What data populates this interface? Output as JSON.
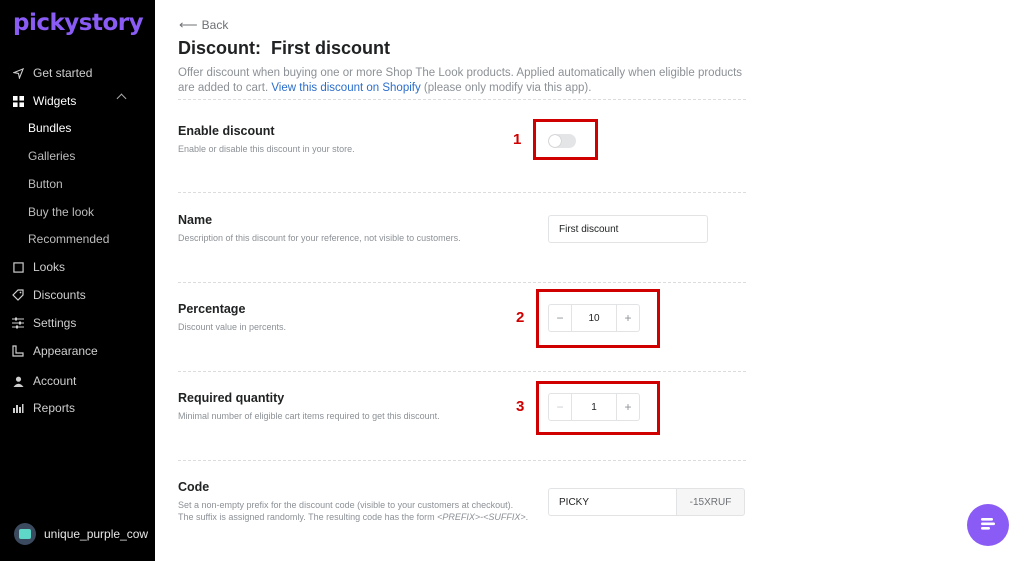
{
  "brand": {
    "logo": "pickystory",
    "accent": "#8a5cf5"
  },
  "sidebar": {
    "items": [
      {
        "label": "Get started",
        "icon": "send-icon"
      },
      {
        "label": "Widgets",
        "icon": "widgets-icon"
      },
      {
        "label": "Looks",
        "icon": "book-icon"
      },
      {
        "label": "Discounts",
        "icon": "tag-icon"
      },
      {
        "label": "Settings",
        "icon": "sliders-icon"
      },
      {
        "label": "Appearance",
        "icon": "ruler-icon"
      },
      {
        "label": "Account",
        "icon": "person-icon"
      },
      {
        "label": "Reports",
        "icon": "chart-icon"
      }
    ],
    "widgets_sub": [
      "Bundles",
      "Galleries",
      "Button",
      "Buy the look",
      "Recommended"
    ],
    "active_sub": "Bundles"
  },
  "user": {
    "name": "unique_purple_cow"
  },
  "header": {
    "back_label": "Back",
    "title": "Discount:  First discount",
    "description_prefix": "Offer discount when buying one or more Shop The Look products. Applied automatically when eligible products are added to cart. ",
    "description_link": "View this discount on Shopify",
    "description_suffix": " (please only modify via this app)."
  },
  "form": {
    "enable": {
      "label": "Enable discount",
      "help": "Enable or disable this discount in your store.",
      "enabled": false
    },
    "name": {
      "label": "Name",
      "help": "Description of this discount for your reference, not visible to customers.",
      "value": "First discount"
    },
    "percentage": {
      "label": "Percentage",
      "help": "Discount value in percents.",
      "value": "10",
      "minus": "−",
      "plus": "+"
    },
    "quantity": {
      "label": "Required quantity",
      "help": "Minimal number of eligible cart items required to get this discount.",
      "value": "1",
      "minus": "−",
      "plus": "+"
    },
    "code": {
      "label": "Code",
      "help_line1": "Set a non-empty prefix for the discount code (visible to your customers at checkout).",
      "help_line2_prefix": "The suffix is assigned randomly. The resulting code has the form ",
      "help_line2_form": "<PREFIX>-<SUFFIX>",
      "help_line2_end": ".",
      "prefix_value": "PICKY",
      "suffix_value": "-15XRUF"
    }
  },
  "annotations": [
    "1",
    "2",
    "3"
  ],
  "annotation_color": "#d10000"
}
